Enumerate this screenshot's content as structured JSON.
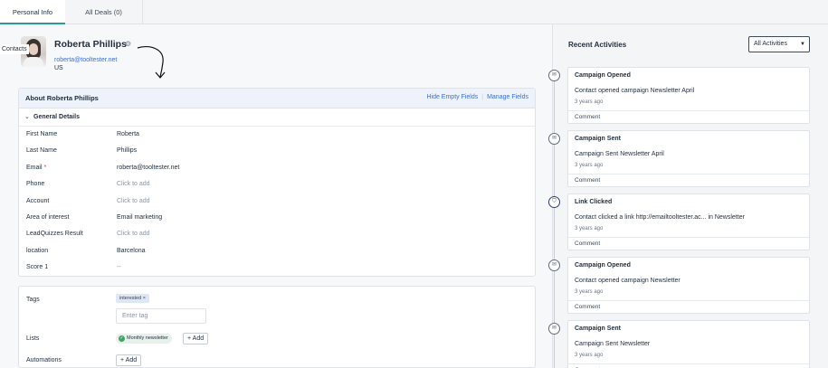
{
  "tabs": [
    {
      "label": "Personal Info"
    },
    {
      "label": "All Deals (0)"
    }
  ],
  "breadcrumb": "Contacts",
  "contact": {
    "name": "Roberta Phillips",
    "email": "roberta@tooltester.net",
    "country": "US"
  },
  "about": {
    "title": "About Roberta Phillips",
    "hide_empty": "Hide Empty Fields",
    "manage_fields": "Manage Fields",
    "section": "General Details",
    "fields": [
      {
        "label": "First Name",
        "value": "Roberta",
        "placeholder": false
      },
      {
        "label": "Last Name",
        "value": "Phillips",
        "placeholder": false
      },
      {
        "label": "Email",
        "value": "roberta@tooltester.net",
        "placeholder": false,
        "required": "*"
      },
      {
        "label": "Phone",
        "value": "Click to add",
        "placeholder": true
      },
      {
        "label": "Account",
        "value": "Click to add",
        "placeholder": true
      },
      {
        "label": "Area of interest",
        "value": "Email marketing",
        "placeholder": false
      },
      {
        "label": "LeadQuizzes Result",
        "value": "Click to add",
        "placeholder": true
      },
      {
        "label": "location",
        "value": "Barcelona",
        "placeholder": false
      },
      {
        "label": "Score 1",
        "value": "--",
        "placeholder": true
      }
    ]
  },
  "tags": {
    "label": "Tags",
    "chip": "interested",
    "chip_close": "×",
    "placeholder": "Enter tag"
  },
  "lists": {
    "label": "Lists",
    "chip": "Monthly newsletter",
    "add": "+ Add"
  },
  "automations": {
    "label": "Automations",
    "add": "+ Add"
  },
  "recent": {
    "title": "Recent Activities",
    "filter": "All Activities",
    "items": [
      {
        "title": "Campaign Opened",
        "desc": "Contact opened campaign Newsletter April",
        "date": "3 years ago",
        "comment": "Comment",
        "icon": "envelope-icon"
      },
      {
        "title": "Campaign Sent",
        "desc": "Campaign Sent Newsletter April",
        "date": "3 years ago",
        "comment": "Comment",
        "icon": "envelope-icon"
      },
      {
        "title": "Link Clicked",
        "desc": "Contact clicked a link http://emailtooltester.ac... in Newsletter",
        "date": "3 years ago",
        "comment": "Comment",
        "icon": "link-icon"
      },
      {
        "title": "Campaign Opened",
        "desc": "Contact opened campaign Newsletter",
        "date": "3 years ago",
        "comment": "Comment",
        "icon": "envelope-icon"
      },
      {
        "title": "Campaign Sent",
        "desc": "Campaign Sent Newsletter",
        "date": "3 years ago",
        "comment": "Comment",
        "icon": "envelope-icon"
      }
    ]
  }
}
